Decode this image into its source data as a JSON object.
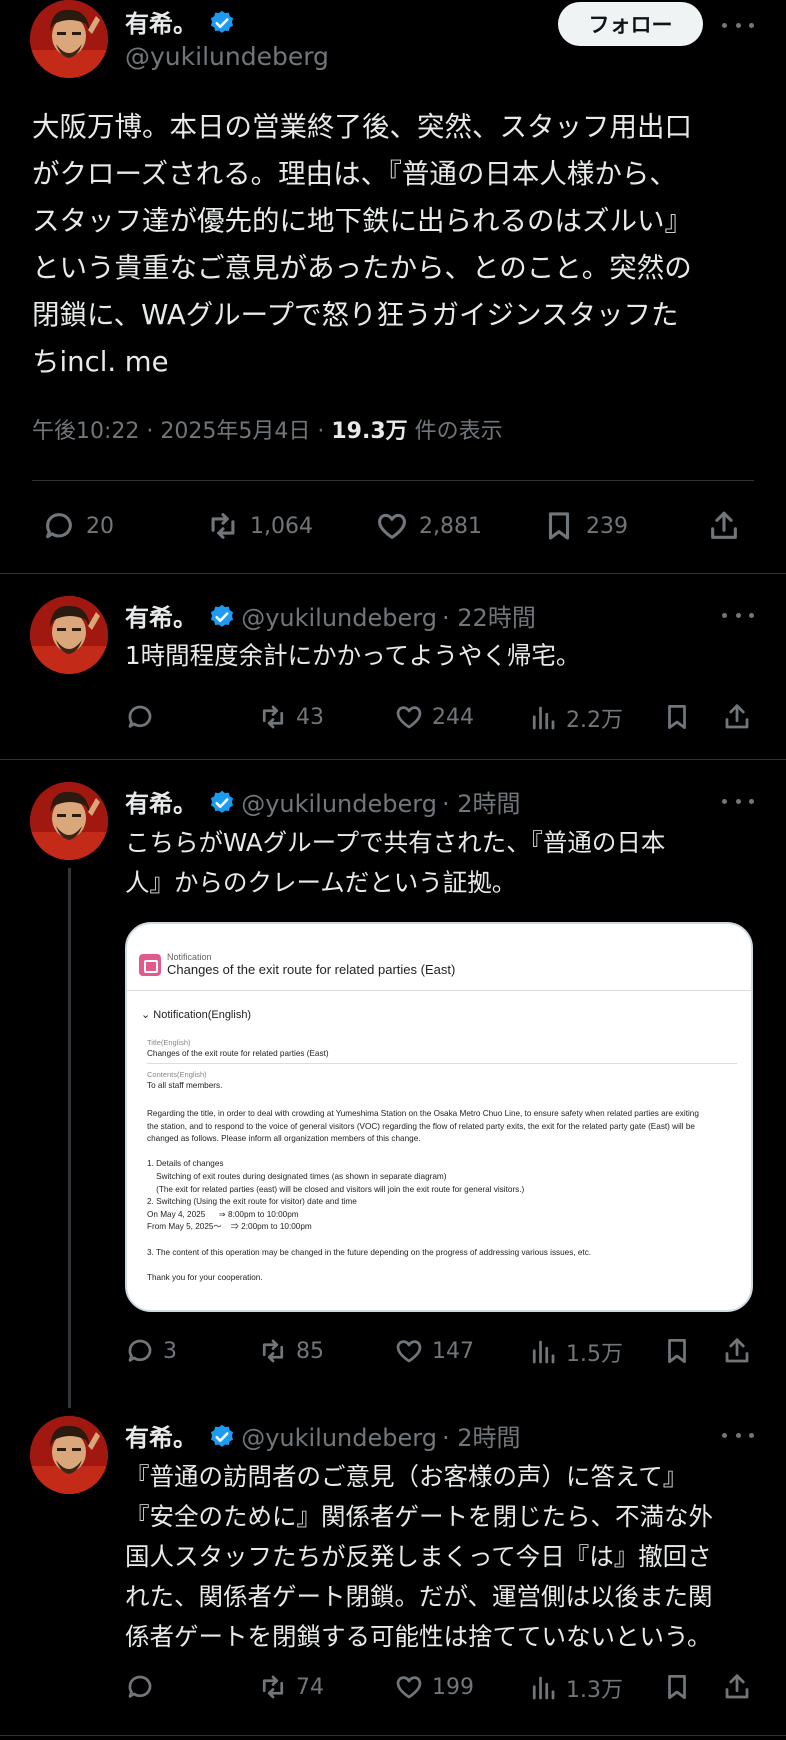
{
  "colors": {
    "background": "#000000",
    "text": "#e7e9ea",
    "muted": "#71767b",
    "verified": "#1d9bf0",
    "divider": "#2f3336"
  },
  "main_tweet": {
    "name": "有希。",
    "handle": "@yukilundeberg",
    "follow_label": "フォロー",
    "text": "大阪万博。本日の営業終了後、突然、スタッフ用出口\nがクローズされる。理由は、『普通の日本人様から、\nスタッフ達が優先的に地下鉄に出られるのはズルい』\nという貴重なご意見があったから、とのこと。突然の\n閉鎖に、WAグループで怒り狂うガイジンスタッフた\nちincl. me",
    "time": "午後10:22 · 2025年5月4日 ·",
    "views": "19.3万",
    "views_label": "件の表示",
    "replies": "20",
    "retweets": "1,064",
    "likes": "2,881",
    "bookmarks": "239",
    "icons": [
      "reply-icon",
      "retweet-icon",
      "like-icon",
      "bookmark-icon",
      "share-icon"
    ]
  },
  "replies": [
    {
      "name": "有希。",
      "handle": "@yukilundeberg",
      "time": "· 22時間",
      "text": "1時間程度余計にかかってようやく帰宅。",
      "replies": "",
      "retweets": "43",
      "likes": "244",
      "views": "2.2万"
    },
    {
      "name": "有希。",
      "handle": "@yukilundeberg",
      "time": "· 2時間",
      "text": "こちらがWAグループで共有された、『普通の日本\n人』からのクレームだという証拠。",
      "replies": "3",
      "retweets": "85",
      "likes": "147",
      "views": "1.5万"
    },
    {
      "name": "有希。",
      "handle": "@yukilundeberg",
      "time": "· 2時間",
      "text": "『普通の訪問者のご意見（お客様の声）に答えて』\n『安全のために』関係者ゲートを閉じたら、不満な外\n国人スタッフたちが反発しまくって今日『は』撤回さ\nれた、関係者ゲート閉鎖。だが、運営側は以後また関\n係者ゲートを閉鎖する可能性は捨てていないという。",
      "replies": "",
      "retweets": "74",
      "likes": "199",
      "views": "1.3万"
    }
  ],
  "notification_card": {
    "label": "Notification",
    "title": "Changes of the exit route for related parties (East)",
    "section": "Notification(English)",
    "title_label": "Title(English)",
    "title_value": "Changes of the exit route for related parties (East)",
    "contents_label": "Contents(English)",
    "contents_value": "To all staff members.",
    "body": "Regarding the title, in order to deal with crowding at Yumeshima Station on the Osaka Metro Chuo Line, to ensure safety when related parties are exiting\nthe station, and to respond to the voice of general visitors (VOC) regarding the flow of related party exits, the exit for the related party gate (East) will be\nchanged as follows. Please inform all organization members of this change.\n\n1. Details of changes\n    Switching of exit routes during designated times (as shown in separate diagram)\n    (The exit for related parties (east) will be closed and visitors will join the exit route for general visitors.)\n2. Switching (Using the exit route for visitor) date and time\nOn May 4, 2025      ⇒ 8:00pm to 10:00pm\nFrom May 5, 2025～    ⇒ 2:00pm to 10:00pm\n\n3. The content of this operation may be changed in the future depending on the progress of addressing various issues, etc.\n\nThank you for your cooperation."
  }
}
